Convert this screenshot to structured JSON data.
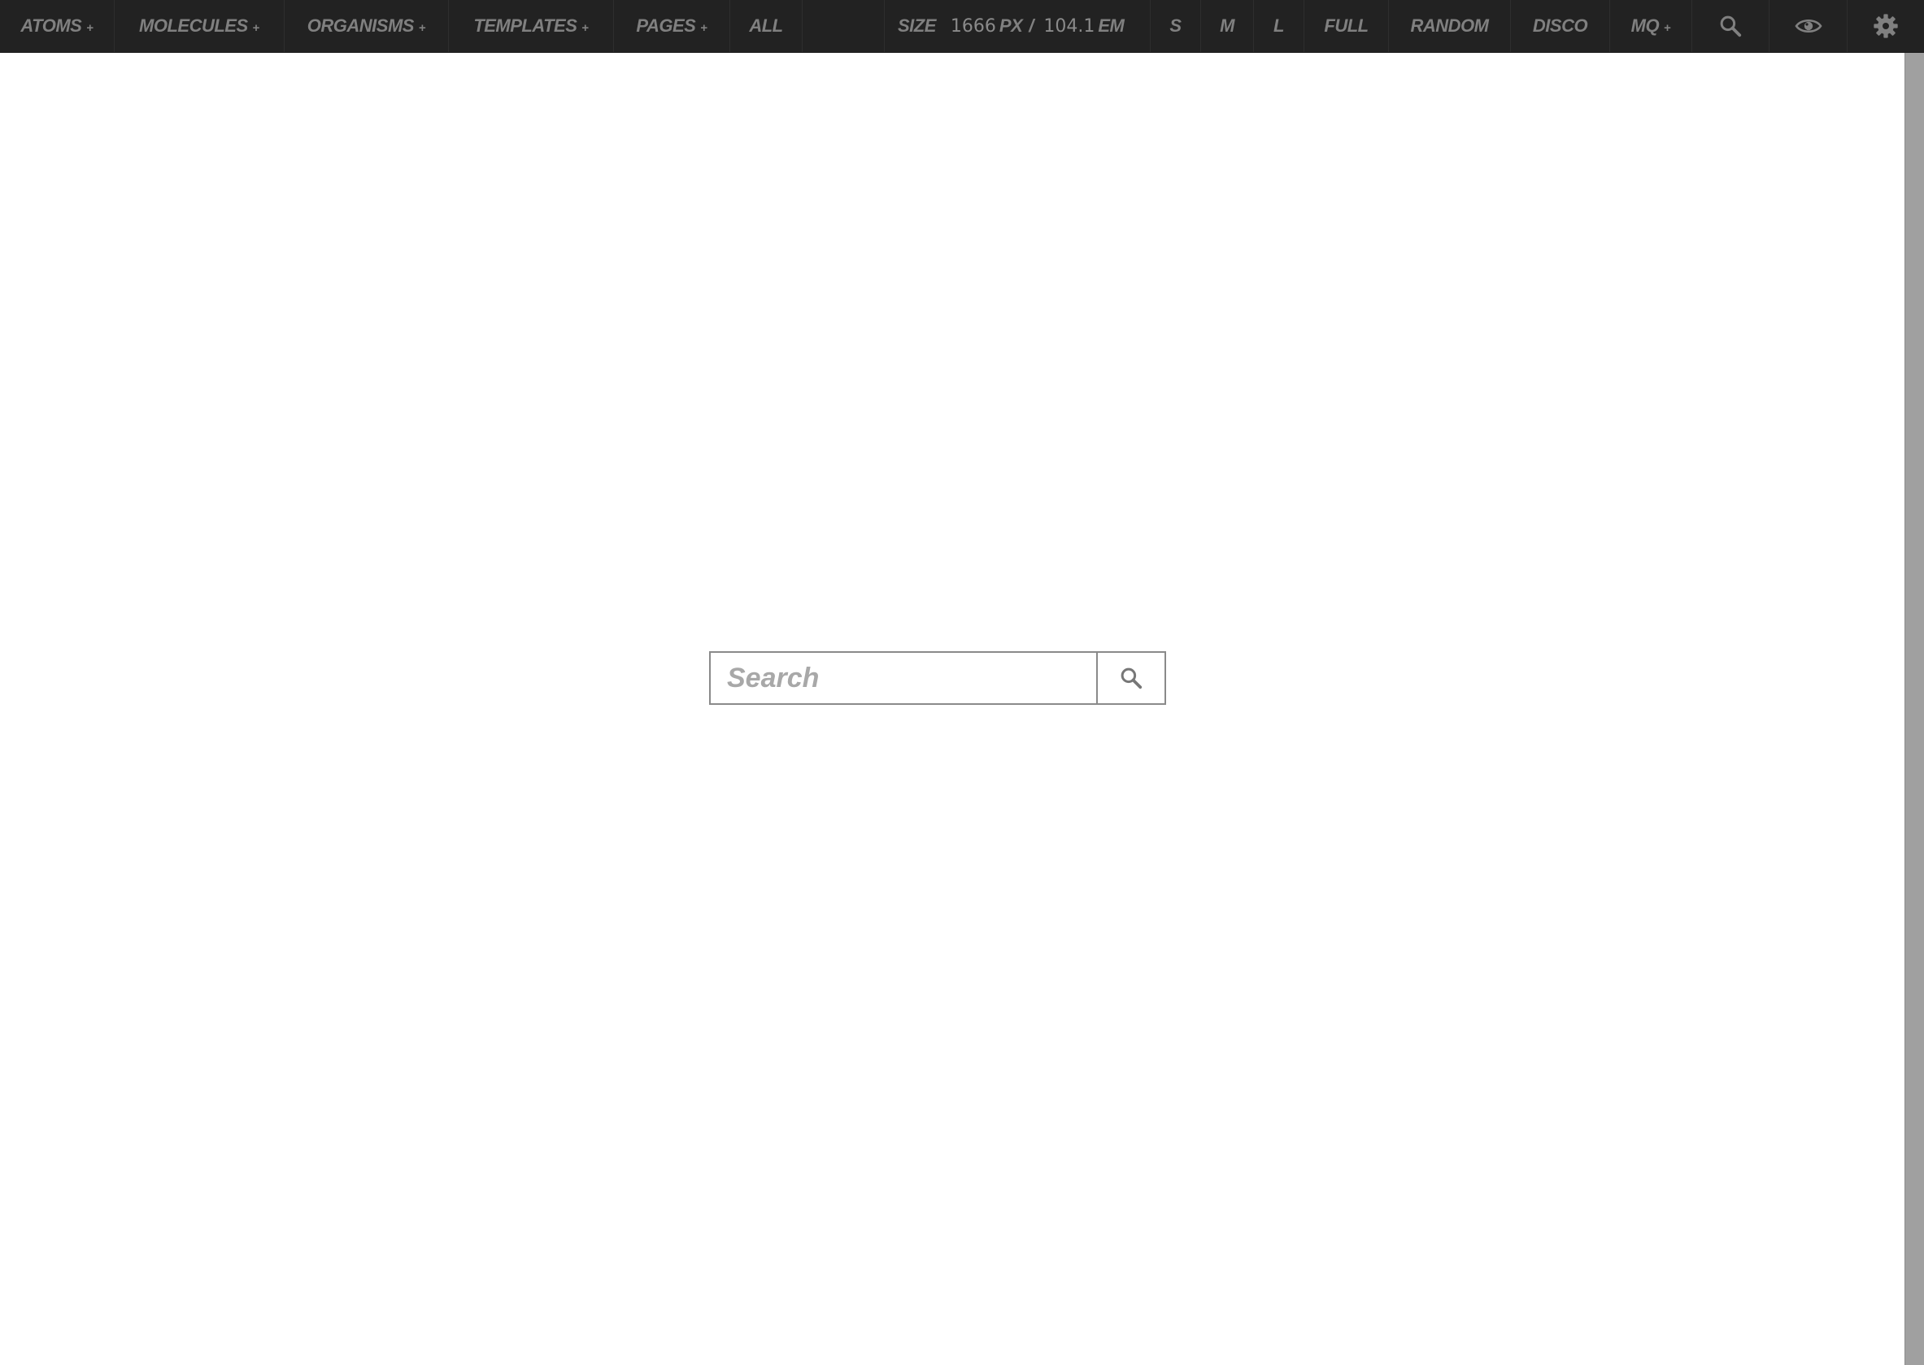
{
  "toolbar": {
    "nav": [
      {
        "label": "ATOMS",
        "has_menu": true
      },
      {
        "label": "MOLECULES",
        "has_menu": true
      },
      {
        "label": "ORGANISMS",
        "has_menu": true
      },
      {
        "label": "TEMPLATES",
        "has_menu": true
      },
      {
        "label": "PAGES",
        "has_menu": true
      },
      {
        "label": "ALL",
        "has_menu": false
      }
    ],
    "menu_indicator": "+",
    "size": {
      "label": "SIZE",
      "px_value": "1666",
      "px_unit": "PX",
      "separator": "/",
      "em_value": "104.1",
      "em_unit": "EM"
    },
    "sizes": {
      "small": "S",
      "medium": "M",
      "large": "L",
      "full": "FULL",
      "random": "RANDOM",
      "disco": "DISCO"
    },
    "mq": {
      "label": "MQ",
      "has_menu": true
    },
    "icons": [
      "search-icon",
      "eye-icon",
      "gear-icon"
    ]
  },
  "search": {
    "placeholder": "Search",
    "value": "",
    "button_icon": "search-icon"
  },
  "colors": {
    "toolbar_bg": "#222222",
    "toolbar_text": "#808080",
    "page_bg": "#ffffff",
    "scrollbar": "#a0a0a0",
    "input_border": "#8a8a8a",
    "placeholder": "#a8a8a8"
  }
}
